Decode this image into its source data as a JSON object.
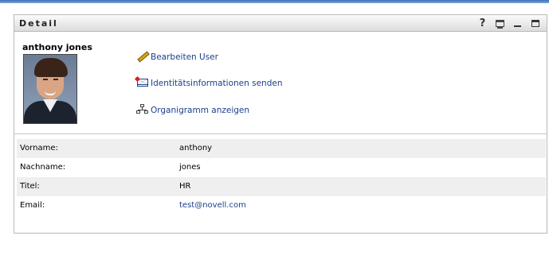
{
  "portlet": {
    "title": "Detail",
    "help_label": "?",
    "icons": [
      "help-icon",
      "print-icon",
      "minimize-icon",
      "maximize-icon"
    ]
  },
  "user": {
    "name": "anthony jones"
  },
  "actions": [
    {
      "icon": "pencil-icon",
      "label": "Bearbeiten User"
    },
    {
      "icon": "email-icon",
      "label": "Identitätsinformationen senden"
    },
    {
      "icon": "org-chart-icon",
      "label": "Organigramm anzeigen"
    }
  ],
  "fields": [
    {
      "label": "Vorname:",
      "value": "anthony"
    },
    {
      "label": "Nachname:",
      "value": "jones"
    },
    {
      "label": "Titel:",
      "value": "HR"
    },
    {
      "label": "Email:",
      "value": "test@novell.com"
    }
  ],
  "colors": {
    "link": "#1a3f8a",
    "row_alt": "#efefef",
    "border": "#b9b9b9"
  }
}
